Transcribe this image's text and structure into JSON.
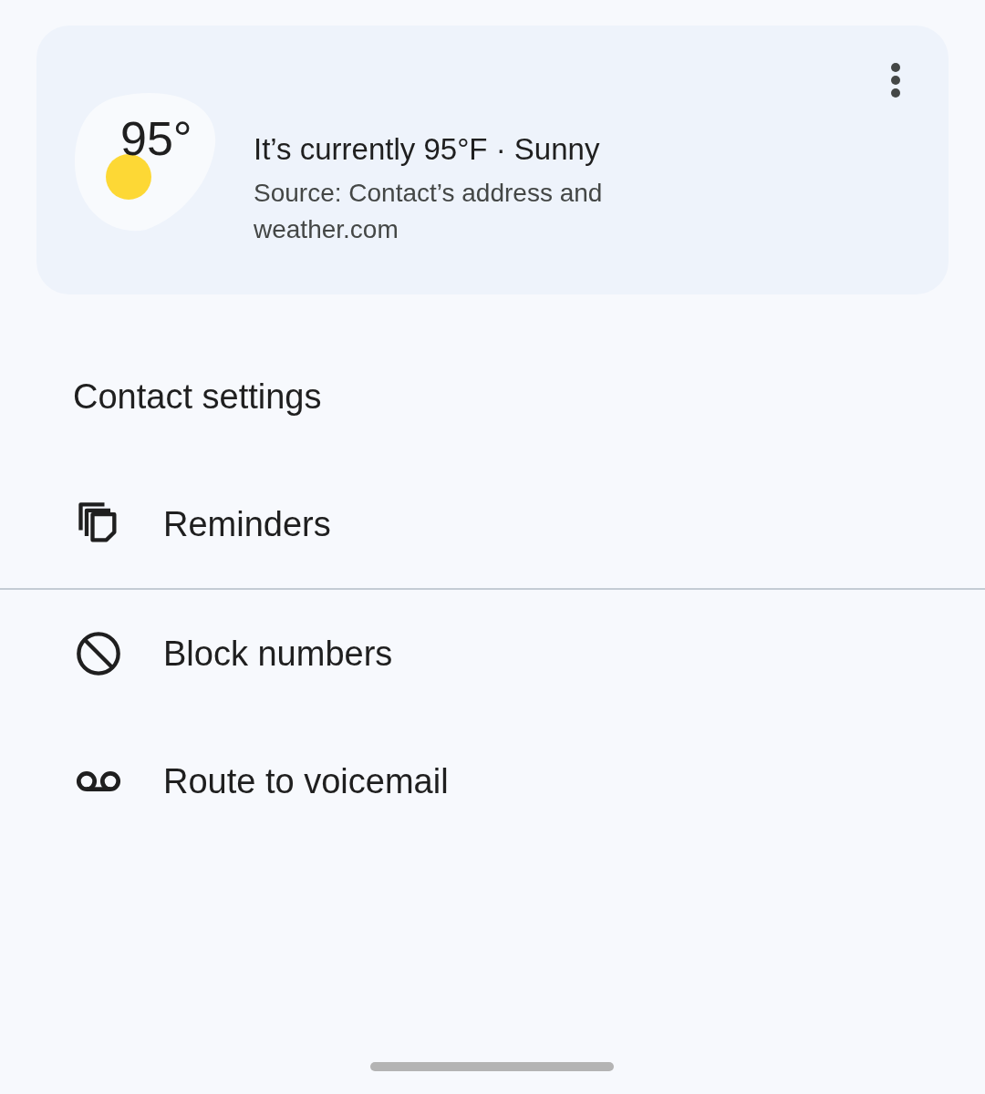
{
  "weather_card": {
    "temperature": "95°",
    "summary": "It’s currently 95°F · Sunny",
    "source": "Source: Contact’s address and weather.com"
  },
  "section_title": "Contact settings",
  "settings": [
    {
      "kind": "reminders",
      "label": "Reminders",
      "divider_after": true
    },
    {
      "kind": "block",
      "label": "Block numbers",
      "divider_after": false
    },
    {
      "kind": "voicemail",
      "label": "Route to voicemail",
      "divider_after": false
    }
  ]
}
